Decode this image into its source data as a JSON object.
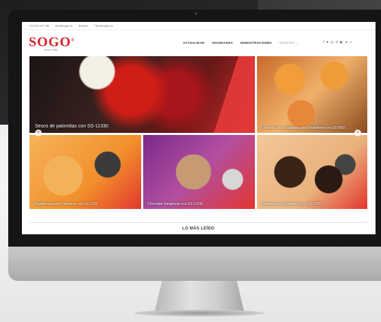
{
  "topbar": {
    "items": [
      "+34 902 197 082",
      "info@sogo.es",
      "Soporte",
      "Tienda sogo.es"
    ]
  },
  "header": {
    "logo_text": "SOGO",
    "logo_reg": "®",
    "logo_sub": "Since 1982"
  },
  "nav": {
    "items": [
      "ACTUALIDAD",
      "NOVEDADES",
      "DEMOSTRACIONES",
      "RECETAS ⌄"
    ]
  },
  "social": {
    "icons": [
      "facebook-icon",
      "twitter-icon",
      "instagram-icon",
      "pinterest-icon",
      "youtube-icon",
      "rss-icon",
      "search-icon"
    ],
    "glyphs": [
      "f",
      "♥",
      "◎",
      "℗",
      "▶",
      "≋",
      "⌕"
    ]
  },
  "tiles": [
    {
      "caption": "Sesos de palomitas con SS-11330"
    },
    {
      "caption": "Churros Cris de calabaza para Halloween con SS-3665"
    },
    {
      "caption": "Magdalenas para Halloween con SS-7185"
    },
    {
      "caption": "Chocolate Sangriento con SS-11930"
    },
    {
      "caption": "Brownies para Halloween con SS-7195"
    }
  ],
  "carousel": {
    "prev": "‹",
    "next": "›"
  },
  "section": {
    "title": "LO MÁS LEÍDO"
  },
  "colors": {
    "brand": "#d3222a",
    "accent": "#e33a3a"
  }
}
